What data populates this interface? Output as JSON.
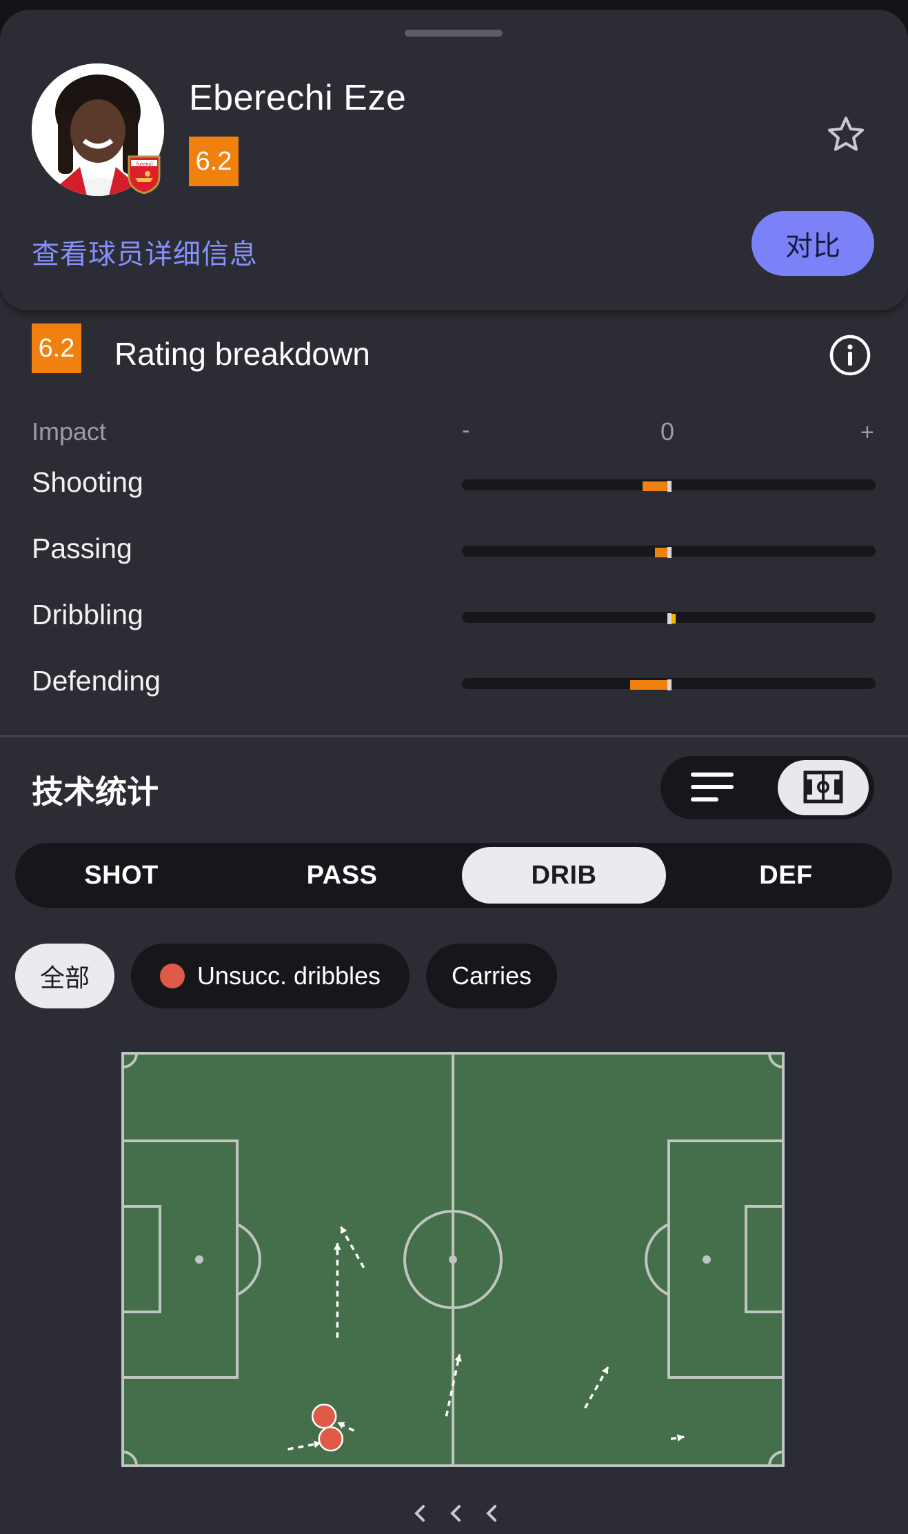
{
  "player": {
    "name": "Eberechi Eze",
    "rating": "6.2",
    "details_link": "查看球员详细信息",
    "compare_label": "对比",
    "club_badge_text": "Arsenal"
  },
  "rating_breakdown": {
    "badge": "6.2",
    "title": "Rating breakdown",
    "scale": {
      "label": "Impact",
      "minus": "-",
      "zero": "0",
      "plus": "+"
    },
    "rows": [
      {
        "label": "Shooting",
        "value": -0.12
      },
      {
        "label": "Passing",
        "value": -0.06
      },
      {
        "label": "Dribbling",
        "value": 0.02
      },
      {
        "label": "Defending",
        "value": -0.18
      }
    ]
  },
  "technical": {
    "title": "技术统计",
    "view_modes": [
      "list-icon",
      "pitch-icon"
    ],
    "active_view": "pitch-icon",
    "tabs": [
      "SHOT",
      "PASS",
      "DRIB",
      "DEF"
    ],
    "active_tab": "DRIB",
    "filters": [
      {
        "label": "全部",
        "active": true
      },
      {
        "label": "Unsucc. dribbles",
        "active": false,
        "dot_color": "#e05a4a"
      },
      {
        "label": "Carries",
        "active": false
      }
    ]
  },
  "colors": {
    "accent_orange": "#f0810f",
    "link": "#8690ff",
    "compare_button": "#7b82f7",
    "pitch_green": "#456f4a",
    "unsuccessful_dribble": "#e05a4a"
  },
  "pitch_events": {
    "carries": [
      {
        "from": [
          0.325,
          0.69
        ],
        "to": [
          0.325,
          0.46
        ]
      },
      {
        "from": [
          0.365,
          0.52
        ],
        "to": [
          0.33,
          0.42
        ]
      },
      {
        "from": [
          0.49,
          0.88
        ],
        "to": [
          0.51,
          0.73
        ]
      },
      {
        "from": [
          0.7,
          0.86
        ],
        "to": [
          0.735,
          0.76
        ]
      },
      {
        "from": [
          0.83,
          0.935
        ],
        "to": [
          0.85,
          0.93
        ]
      },
      {
        "from": [
          0.25,
          0.96
        ],
        "to": [
          0.3,
          0.945
        ]
      },
      {
        "from": [
          0.35,
          0.915
        ],
        "to": [
          0.325,
          0.895
        ]
      }
    ],
    "unsuccessful_dribbles": [
      {
        "at": [
          0.305,
          0.88
        ]
      },
      {
        "at": [
          0.315,
          0.935
        ]
      }
    ]
  }
}
